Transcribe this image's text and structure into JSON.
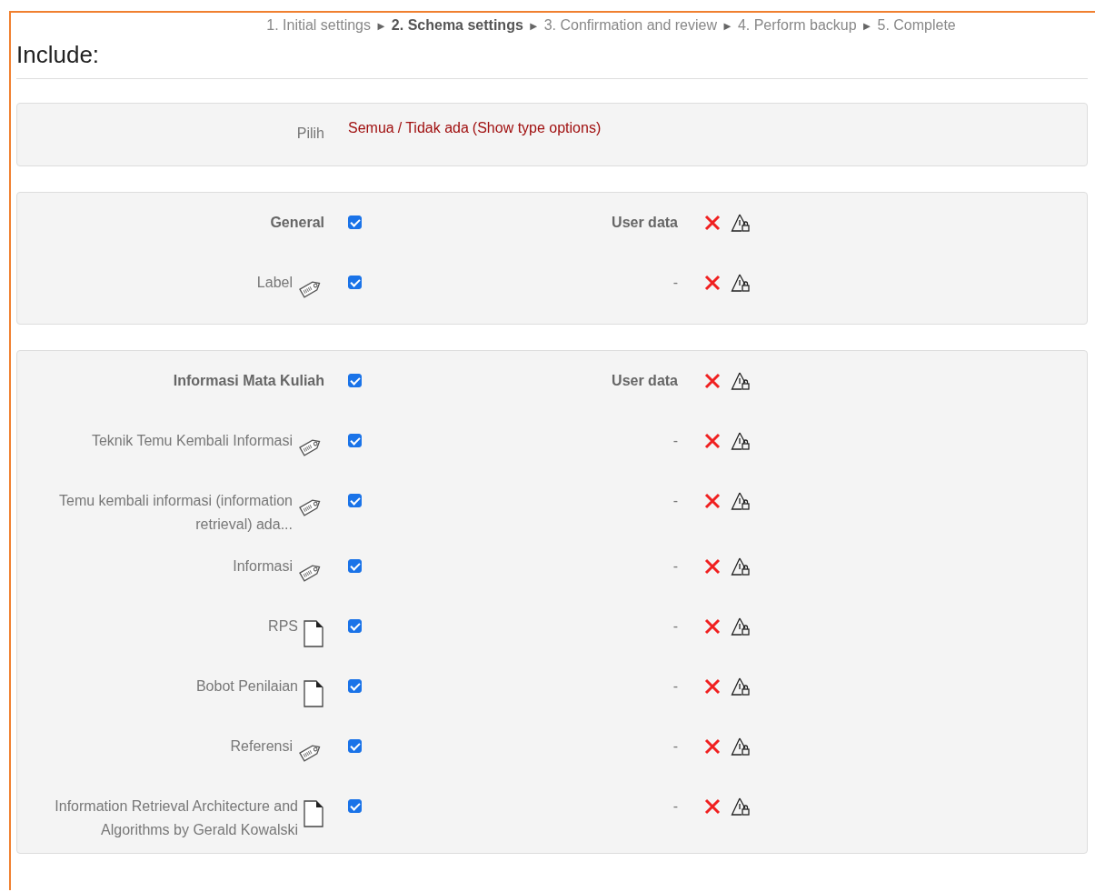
{
  "steps": [
    {
      "label": "1. Initial settings",
      "selected": false
    },
    {
      "label": "2. Schema settings",
      "selected": true
    },
    {
      "label": "3. Confirmation and review",
      "selected": false
    },
    {
      "label": "4. Perform backup",
      "selected": false
    },
    {
      "label": "5. Complete",
      "selected": false
    }
  ],
  "step_separator": "►",
  "heading": "Include:",
  "select_row": {
    "label": "Pilih",
    "all": "Semua",
    "separator": "/",
    "none": "Tidak ada",
    "show_types": "(Show type options)"
  },
  "sections": [
    {
      "title": "General",
      "checked": true,
      "userdata": "User data",
      "items": [
        {
          "label": "Label",
          "kind": "tag",
          "checked": true,
          "userdata": "-"
        }
      ]
    },
    {
      "title": "Informasi Mata Kuliah",
      "checked": true,
      "userdata": "User data",
      "items": [
        {
          "label": "Teknik Temu Kembali Informasi",
          "kind": "tag",
          "checked": true,
          "userdata": "-"
        },
        {
          "label": "Temu kembali informasi (information retrieval) ada...",
          "kind": "tag",
          "checked": true,
          "userdata": "-"
        },
        {
          "label": "Informasi",
          "kind": "tag",
          "checked": true,
          "userdata": "-"
        },
        {
          "label": "RPS",
          "kind": "file",
          "checked": true,
          "userdata": "-"
        },
        {
          "label": "Bobot Penilaian",
          "kind": "file",
          "checked": true,
          "userdata": "-"
        },
        {
          "label": "Referensi",
          "kind": "tag",
          "checked": true,
          "userdata": "-"
        },
        {
          "label": "Information Retrieval Architecture and Algorithms by Gerald Kowalski",
          "kind": "file",
          "checked": true,
          "userdata": "-"
        }
      ]
    }
  ]
}
